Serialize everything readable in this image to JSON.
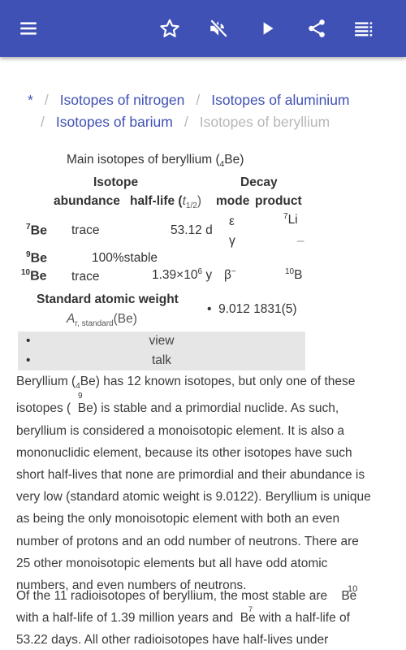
{
  "toolbar": {
    "bg_color": "#3F51B5",
    "icons": [
      "menu-icon",
      "star-icon",
      "volume-off-icon",
      "play-icon",
      "share-icon",
      "playlist-icon"
    ]
  },
  "breadcrumb": {
    "home": "*",
    "separator": "/",
    "links": [
      "Isotopes of nitrogen",
      "Isotopes of aluminium",
      "Isotopes of barium"
    ],
    "current": "Isotopes of beryllium"
  },
  "infobox": {
    "caption_prefix": "Main isotopes of beryllium (",
    "caption_sub": "4",
    "caption_suffix": "Be)",
    "header_isotope": "Isotope",
    "header_decay": "Decay",
    "col_abundance": "abundance",
    "col_halflife": "half-life (",
    "col_halflife_sym": "t",
    "col_halflife_sub": "1/2",
    "col_halflife_close": ")",
    "col_mode": "mode",
    "col_product": "product",
    "rows": [
      {
        "mass": "7",
        "symbol": "Be",
        "abundance": "trace",
        "halflife": "53.12 d",
        "modes": [
          "ε",
          "γ"
        ],
        "products": [
          {
            "mass": "7",
            "symbol": "Li"
          },
          {
            "mass": "",
            "symbol": "–"
          }
        ]
      },
      {
        "mass": "9",
        "symbol": "Be",
        "abundance": "100%",
        "halflife": "stable"
      },
      {
        "mass": "10",
        "symbol": "Be",
        "abundance": "trace",
        "halflife_base": "1.39×10",
        "halflife_exp": "6",
        "halflife_unit": " y",
        "mode": "β",
        "mode_sup": "−",
        "product_mass": "10",
        "product_symbol": "B"
      }
    ],
    "saw_label": "Standard atomic weight",
    "saw_symbol": "A",
    "saw_sub": "r, standard",
    "saw_element": "(Be)",
    "saw_value": "9.012 1831(5)",
    "bullet": "•"
  },
  "links_bar": {
    "items": [
      "view",
      "talk"
    ]
  },
  "paragraphs": {
    "p1": {
      "lines": [
        [
          "Beryllium (",
          "4",
          "Be) has 12 known isotopes, but only one of these"
        ],
        "isotopes (  Be) is stable and a primordial nuclide. As such,",
        "beryllium is considered a monoisotopic element. It is also a",
        "mononuclidic element, because its other isotopes have such",
        "short half-lives that none are primordial and their abundance is",
        "very low (standard atomic weight is 9.0122). Beryllium is unique",
        "as being the only monoisotopic element with both an even",
        "number of protons and an odd number of neutrons. There are",
        "25 other monoisotopic elements but all have odd atomic",
        "numbers, and even numbers of neutrons."
      ],
      "floating_sup": "9"
    },
    "p2": {
      "lines": [
        "Of the 11 radioisotopes of beryllium, the most stable are    Be",
        "with a half-life of 1.39 million years and  Be with a half-life of",
        "53.22 days. All other radioisotopes have half-lives under"
      ],
      "floating_sup_10": "10",
      "floating_sup_7": "7"
    }
  }
}
